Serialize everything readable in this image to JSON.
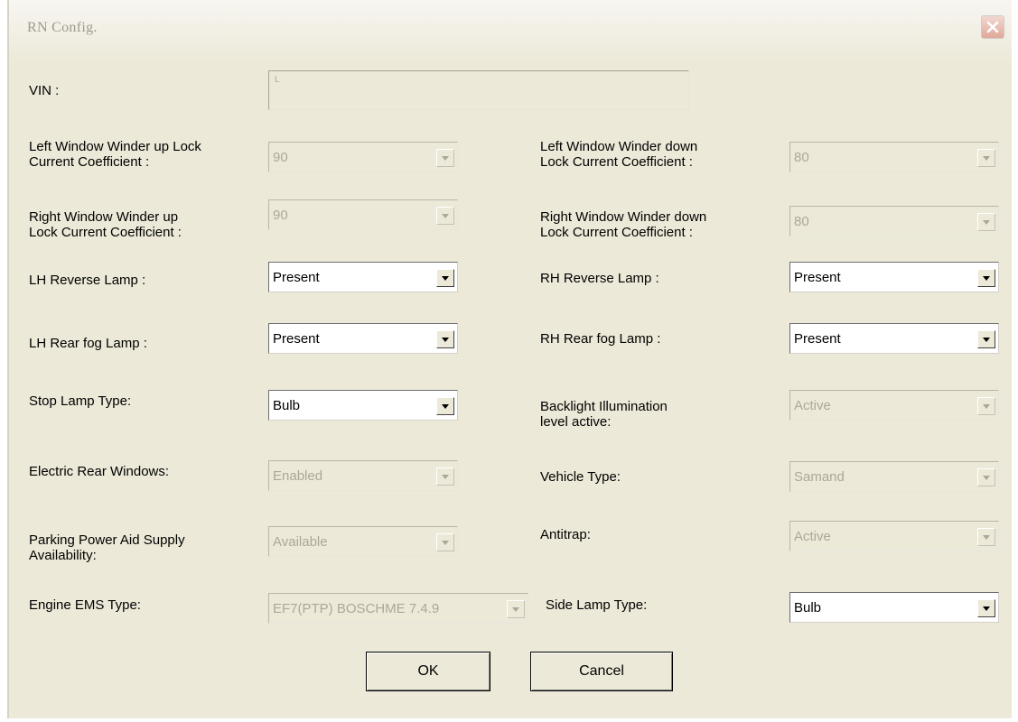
{
  "window": {
    "title": "RN Config."
  },
  "vin": {
    "label": "VIN :",
    "value": "L"
  },
  "fields": {
    "lh_up_lock": {
      "label": "Left Window Winder up Lock\nCurrent Coefficient :",
      "value": "90"
    },
    "lh_down_lock": {
      "label": "Left Window Winder down\nLock Current Coefficient :",
      "value": "80"
    },
    "rh_up_lock": {
      "label": "Right Window Winder up\nLock Current Coefficient :",
      "value": "90"
    },
    "rh_down_lock": {
      "label": "Right Window Winder down\nLock Current Coefficient :",
      "value": "80"
    },
    "lh_reverse": {
      "label": "LH Reverse Lamp :",
      "value": "Present"
    },
    "rh_reverse": {
      "label": "RH Reverse Lamp :",
      "value": "Present"
    },
    "lh_fog": {
      "label": "LH Rear fog Lamp :",
      "value": "Present"
    },
    "rh_fog": {
      "label": "RH Rear fog Lamp :",
      "value": "Present"
    },
    "stop_lamp": {
      "label": "Stop Lamp Type:",
      "value": "Bulb"
    },
    "backlight": {
      "label": "Backlight Illumination\nlevel active:",
      "value": "Active"
    },
    "rear_windows": {
      "label": "Electric Rear Windows:",
      "value": "Enabled"
    },
    "vehicle_type": {
      "label": "Vehicle Type:",
      "value": "Samand"
    },
    "parking_aid": {
      "label": "Parking Power Aid Supply\nAvailability:",
      "value": "Available"
    },
    "antitrap": {
      "label": "Antitrap:",
      "value": "Active"
    },
    "engine_ems": {
      "label": "Engine EMS Type:",
      "value": "EF7(PTP) BOSCHME 7.4.9"
    },
    "side_lamp": {
      "label": "Side Lamp Type:",
      "value": "Bulb"
    }
  },
  "buttons": {
    "ok": "OK",
    "cancel": "Cancel"
  },
  "icons": {
    "close": "close-icon",
    "dropdown": "chevron-down-icon"
  },
  "colors": {
    "dialog_bg": "#ece9d8",
    "close_btn": "#e0a89a",
    "disabled_text": "#aca899"
  }
}
